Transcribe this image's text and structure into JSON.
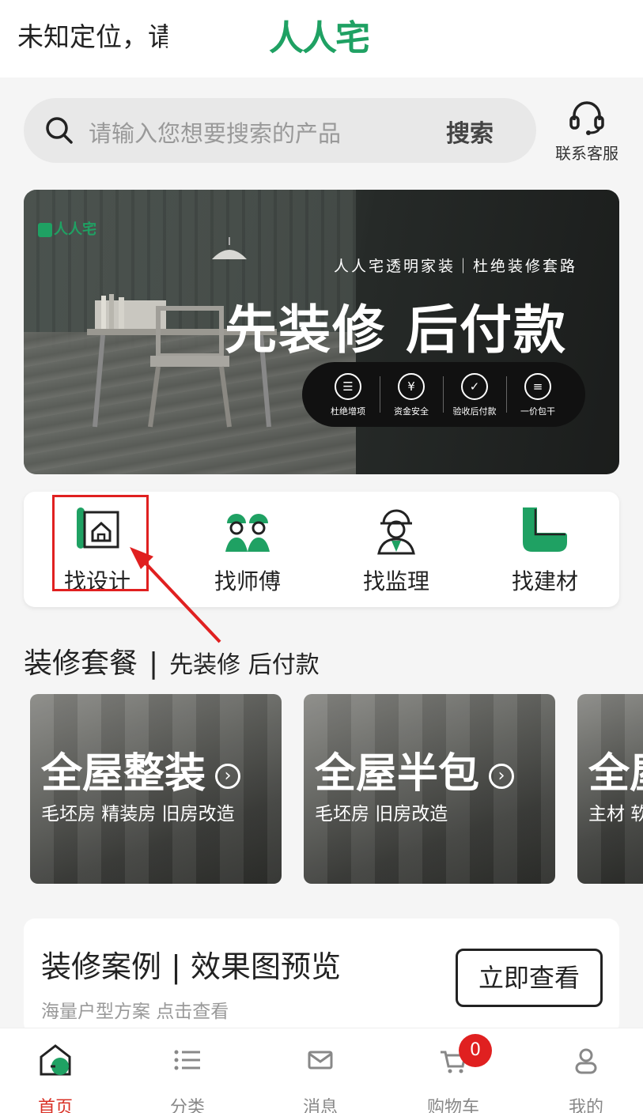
{
  "header": {
    "location": "未知定位，请",
    "logo": "人人宅"
  },
  "search": {
    "placeholder": "请输入您想要搜索的产品",
    "button": "搜索"
  },
  "service": {
    "label": "联系客服"
  },
  "banner": {
    "brand": "人人宅",
    "subtitle": "人人宅透明家装｜杜绝装修套路",
    "headline": "先装修 后付款",
    "features": [
      "杜绝增项",
      "资金安全",
      "验收后付款",
      "一价包干"
    ]
  },
  "quick": {
    "items": [
      {
        "label": "找设计",
        "icon": "blueprint-house-icon"
      },
      {
        "label": "找师傅",
        "icon": "workers-icon"
      },
      {
        "label": "找监理",
        "icon": "supervisor-icon"
      },
      {
        "label": "找建材",
        "icon": "building-material-icon"
      }
    ]
  },
  "packages": {
    "title": "装修套餐",
    "divider": "|",
    "tagline": "先装修  后付款",
    "cards": [
      {
        "title": "全屋整装",
        "sub": "毛坯房 精装房 旧房改造"
      },
      {
        "title": "全屋半包",
        "sub": "毛坯房 旧房改造"
      },
      {
        "title": "全屋",
        "sub": "主材 软"
      }
    ]
  },
  "cases": {
    "title": "装修案例 | 效果图预览",
    "subtitle": "海量户型方案 点击查看",
    "button": "立即查看"
  },
  "tabbar": {
    "items": [
      "首页",
      "分类",
      "消息",
      "购物车",
      "我的"
    ],
    "cart_badge": "0"
  },
  "colors": {
    "brand_green": "#1fa163",
    "active_red": "#d93025",
    "highlight_red": "#e02020"
  }
}
